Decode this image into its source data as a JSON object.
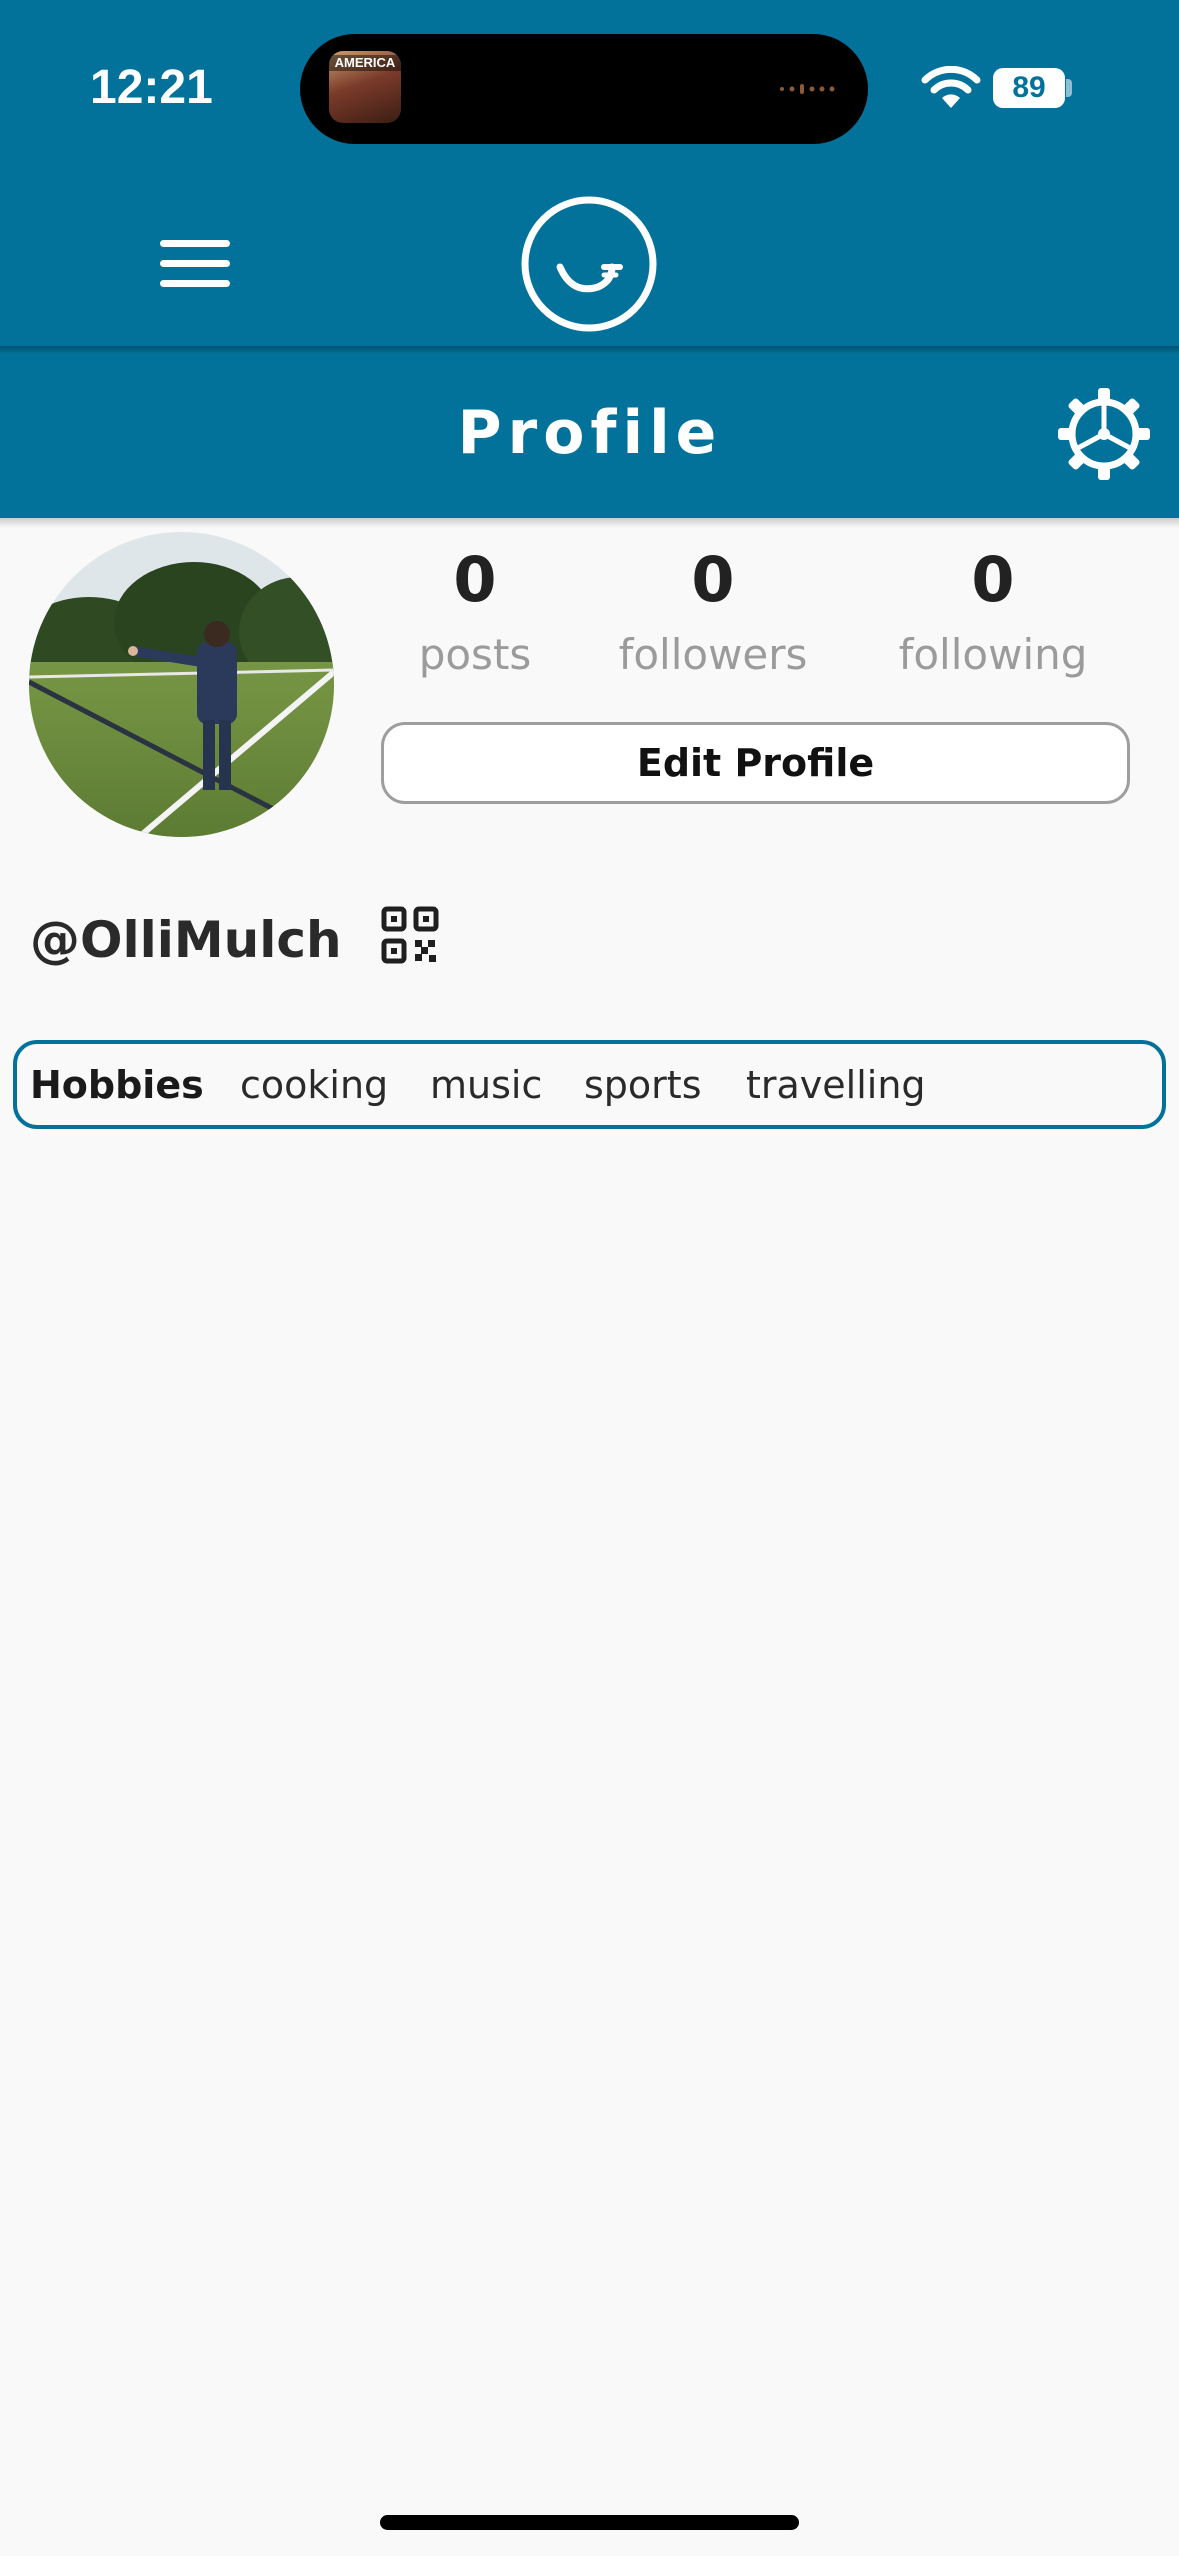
{
  "status_bar": {
    "time": "12:21",
    "battery_level": "89",
    "now_playing_art_text": "AMERICA"
  },
  "nav": {
    "menu_icon": "hamburger-icon",
    "logo_icon": "smile-logo-icon"
  },
  "header": {
    "title": "Profile",
    "settings_icon": "gear-icon"
  },
  "profile": {
    "stats": [
      {
        "value": "0",
        "label": "posts"
      },
      {
        "value": "0",
        "label": "followers"
      },
      {
        "value": "0",
        "label": "following"
      }
    ],
    "edit_label": "Edit Profile",
    "username": "@OlliMulch",
    "qr_icon": "qr-code-icon"
  },
  "hobbies": {
    "title": "Hobbies",
    "items": [
      "cooking",
      "music",
      "sports",
      "travelling"
    ]
  },
  "colors": {
    "brand": "#03729b",
    "background": "#f9f9f9",
    "muted_text": "#9b9b9b"
  }
}
